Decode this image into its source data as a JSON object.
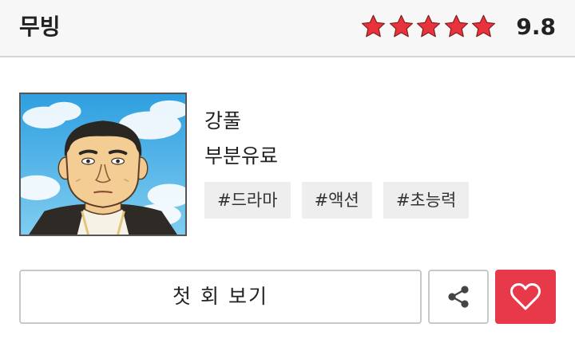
{
  "header": {
    "title": "무빙",
    "rating": {
      "stars": 5,
      "score": "9.8"
    }
  },
  "work": {
    "thumbnail_icon": "cartoon-character-portrait",
    "author": "강풀",
    "pricing": "부분유료",
    "tags": [
      "#드라마",
      "#액션",
      "#초능력"
    ]
  },
  "actions": {
    "first_episode_label": "첫 회 보기",
    "share_icon": "share-icon",
    "like_icon": "heart-icon"
  },
  "colors": {
    "star": "#e8323c",
    "like_button": "#e8394a",
    "header_bg": "#f7f7f7"
  }
}
